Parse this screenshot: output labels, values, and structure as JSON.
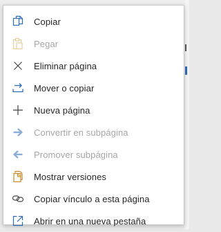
{
  "context_menu": {
    "items": [
      {
        "label": "Copiar",
        "icon": "copy-icon",
        "enabled": true
      },
      {
        "label": "Pegar",
        "icon": "paste-icon",
        "enabled": false
      },
      {
        "label": "Eliminar página",
        "icon": "close-icon",
        "enabled": true
      },
      {
        "label": "Mover o copiar",
        "icon": "move-icon",
        "enabled": true
      },
      {
        "label": "Nueva página",
        "icon": "plus-icon",
        "enabled": true
      },
      {
        "label": "Convertir en subpágina",
        "icon": "arrow-right-icon",
        "enabled": false
      },
      {
        "label": "Promover subpágina",
        "icon": "arrow-left-icon",
        "enabled": false
      },
      {
        "label": "Mostrar versiones",
        "icon": "versions-icon",
        "enabled": true
      },
      {
        "label": "Copiar vínculo a esta página",
        "icon": "link-icon",
        "enabled": true
      },
      {
        "label": "Abrir en una nueva pestaña",
        "icon": "open-new-tab-icon",
        "enabled": true
      }
    ]
  },
  "colors": {
    "accent_blue": "#2e6cb7",
    "disabled_blue": "#7eaee6",
    "icon_orange": "#c98a2b",
    "text": "#262626",
    "text_disabled": "#a6a6a6"
  }
}
